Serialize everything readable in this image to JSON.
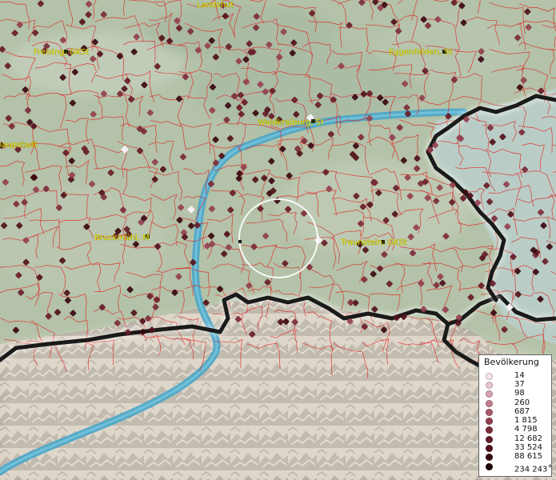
{
  "map": {
    "places": [
      {
        "name": "Landshut"
      },
      {
        "name": "Freising, GKSt"
      },
      {
        "name": "Eggenfelden, St"
      },
      {
        "name": "Waldkraiburg, St"
      },
      {
        "name": "haupstadt"
      },
      {
        "name": "Bruckmühl, M"
      },
      {
        "name": "Traunstein, GKSt"
      }
    ]
  },
  "legend": {
    "title": "Bevölkerung",
    "items": [
      {
        "label": "14",
        "color": "#f7e6ec"
      },
      {
        "label": "37",
        "color": "#ecc8d3"
      },
      {
        "label": "98",
        "color": "#d8a3b2"
      },
      {
        "label": "260",
        "color": "#c28091"
      },
      {
        "label": "687",
        "color": "#a95a6c"
      },
      {
        "label": "1 815",
        "color": "#93404f"
      },
      {
        "label": "4 798",
        "color": "#7d2c39"
      },
      {
        "label": "12 682",
        "color": "#681c28"
      },
      {
        "label": "33 524",
        "color": "#53111b"
      },
      {
        "label": "88 615",
        "color": "#3b0910"
      },
      {
        "label": "234 243",
        "color": "#1c0306",
        "plus": "+"
      }
    ]
  },
  "colors": {
    "river": "#4aa6c8",
    "admin_boundary": "#e02020",
    "state_border": "#1a1a1a",
    "label": "#e7e600",
    "lake": "#b9cdc6",
    "lowland": "#b3c2a8",
    "mountains": "#d9d1c4"
  }
}
